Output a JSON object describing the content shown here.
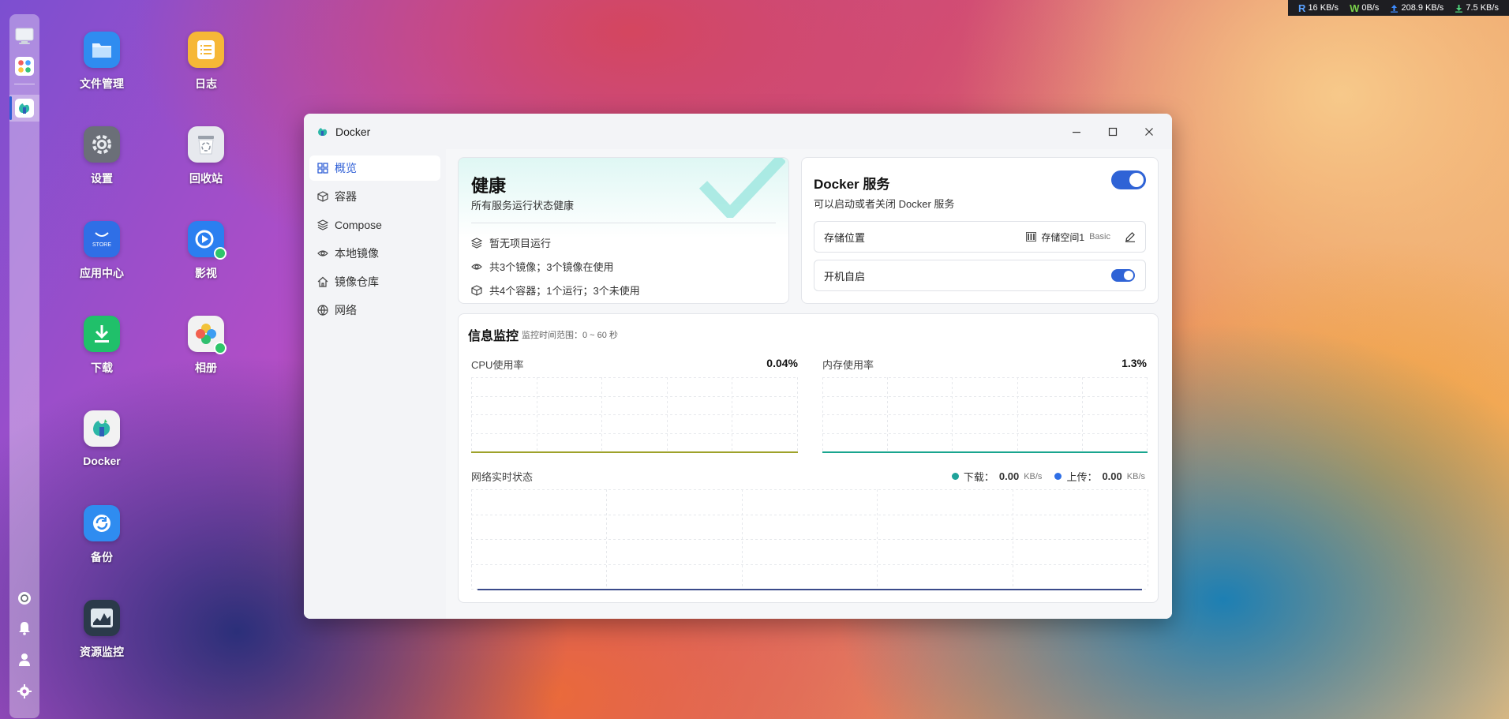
{
  "netbar": {
    "read_tag": "R",
    "read_val": "16 KB/s",
    "write_tag": "W",
    "write_val": "0B/s",
    "up_val": "208.9 KB/s",
    "down_val": "7.5 KB/s"
  },
  "desktop": {
    "icons": [
      {
        "label": "文件管理",
        "icon": "folder-icon",
        "color": "#2f8cf0"
      },
      {
        "label": "日志",
        "icon": "log-icon",
        "color": "#f6b737"
      },
      {
        "label": "设置",
        "icon": "gear-icon",
        "color": "#6b6f78"
      },
      {
        "label": "回收站",
        "icon": "recycle-bin-icon",
        "color": "#e7e9ee"
      },
      {
        "label": "应用中心",
        "icon": "store-icon",
        "color": "#2f6fe6",
        "badge": "STORE"
      },
      {
        "label": "影视",
        "icon": "video-icon",
        "color": "#2b7ff0"
      },
      {
        "label": "下载",
        "icon": "download-icon",
        "color": "#20c06a"
      },
      {
        "label": "相册",
        "icon": "photos-icon",
        "color": "#f2f2f2"
      },
      {
        "label": "Docker",
        "icon": "docker-icon",
        "color": "#f2f2f2"
      },
      {
        "label": "备份",
        "icon": "backup-icon",
        "color": "#2f8cf0"
      },
      {
        "label": "资源监控",
        "icon": "resource-monitor-icon",
        "color": "#2b3a4a"
      }
    ]
  },
  "window": {
    "title": "Docker",
    "sidebar": {
      "items": [
        {
          "label": "概览",
          "icon": "grid-icon",
          "active": true
        },
        {
          "label": "容器",
          "icon": "cube-icon"
        },
        {
          "label": "Compose",
          "icon": "layers-icon"
        },
        {
          "label": "本地镜像",
          "icon": "eye-icon"
        },
        {
          "label": "镜像仓库",
          "icon": "home-icon"
        },
        {
          "label": "网络",
          "icon": "globe-icon"
        }
      ]
    },
    "health": {
      "title": "健康",
      "subtitle": "所有服务运行状态健康",
      "rows": [
        {
          "icon": "layers-icon",
          "text": "暂无项目运行"
        },
        {
          "icon": "eye-icon",
          "text": "共3个镜像；3个镜像在使用"
        },
        {
          "icon": "cube-icon",
          "text": "共4个容器；1个运行；3个未使用"
        }
      ]
    },
    "service": {
      "title": "Docker 服务",
      "subtitle": "可以启动或者关闭 Docker 服务",
      "enabled": true,
      "storage_label": "存储位置",
      "storage_value": "存储空间1",
      "storage_type": "Basic",
      "autostart_label": "开机自启",
      "autostart_enabled": true
    },
    "monitor": {
      "title": "信息监控",
      "range_hint": "监控时间范围：0 ~ 60 秒",
      "cpu_label": "CPU使用率",
      "cpu_value": "0.04%",
      "mem_label": "内存使用率",
      "mem_value": "1.3%",
      "net_label": "网络实时状态",
      "download_label": "下载：",
      "download_value": "0.00",
      "download_unit": "KB/s",
      "upload_label": "上传：",
      "upload_value": "0.00",
      "upload_unit": "KB/s",
      "download_color": "#1fa39a",
      "upload_color": "#2f6fe6"
    }
  },
  "colors": {
    "accent": "#2f5fd6",
    "health_check": "#9be6df",
    "cpu_line": "#9ea22a",
    "mem_line": "#19a58f",
    "net_line": "#3a4a8a"
  }
}
